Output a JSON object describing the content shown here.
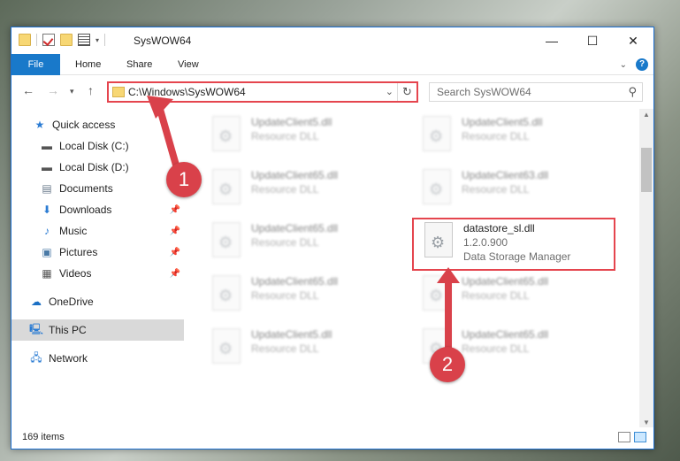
{
  "window": {
    "title": "SysWOW64",
    "controls": {
      "minimize": "—",
      "maximize": "☐",
      "close": "✕"
    }
  },
  "ribbon": {
    "tabs": [
      "File",
      "Home",
      "Share",
      "View"
    ]
  },
  "address": {
    "path": "C:\\Windows\\SysWOW64",
    "search_placeholder": "Search SysWOW64"
  },
  "sidebar": {
    "items": [
      {
        "label": "Quick access",
        "icon": "star-icon",
        "pinned": false
      },
      {
        "label": "Local Disk (C:)",
        "icon": "drive-icon",
        "pinned": false
      },
      {
        "label": "Local Disk (D:)",
        "icon": "drive-icon",
        "pinned": false
      },
      {
        "label": "Documents",
        "icon": "documents-icon",
        "pinned": false
      },
      {
        "label": "Downloads",
        "icon": "download-icon",
        "pinned": true
      },
      {
        "label": "Music",
        "icon": "music-icon",
        "pinned": true
      },
      {
        "label": "Pictures",
        "icon": "pictures-icon",
        "pinned": true
      },
      {
        "label": "Videos",
        "icon": "videos-icon",
        "pinned": true
      },
      {
        "label": "OneDrive",
        "icon": "cloud-icon",
        "pinned": false
      },
      {
        "label": "This PC",
        "icon": "computer-icon",
        "pinned": false,
        "selected": true
      },
      {
        "label": "Network",
        "icon": "network-icon",
        "pinned": false
      }
    ]
  },
  "files": [
    {
      "name": "UpdateClient5.dll",
      "type": "Resource DLL"
    },
    {
      "name": "UpdateClient5.dll",
      "type": "Resource DLL"
    },
    {
      "name": "UpdateClient65.dll",
      "type": "Resource DLL"
    },
    {
      "name": "UpdateClient63.dll",
      "type": "Resource DLL"
    },
    {
      "name": "UpdateClient65.dll",
      "type": "Resource DLL"
    },
    {
      "name": "datastore_sl.dll",
      "version": "1.2.0.900",
      "type": "Data Storage Manager"
    },
    {
      "name": "UpdateClient65.dll",
      "type": "Resource DLL"
    },
    {
      "name": "UpdateClient65.dll",
      "type": "Resource DLL"
    },
    {
      "name": "UpdateClient5.dll",
      "type": "Resource DLL"
    },
    {
      "name": "UpdateClient65.dll",
      "type": "Resource DLL"
    }
  ],
  "status": {
    "item_count": "169 items"
  },
  "annotations": {
    "step1": "1",
    "step2": "2",
    "color": "#d9414a"
  }
}
